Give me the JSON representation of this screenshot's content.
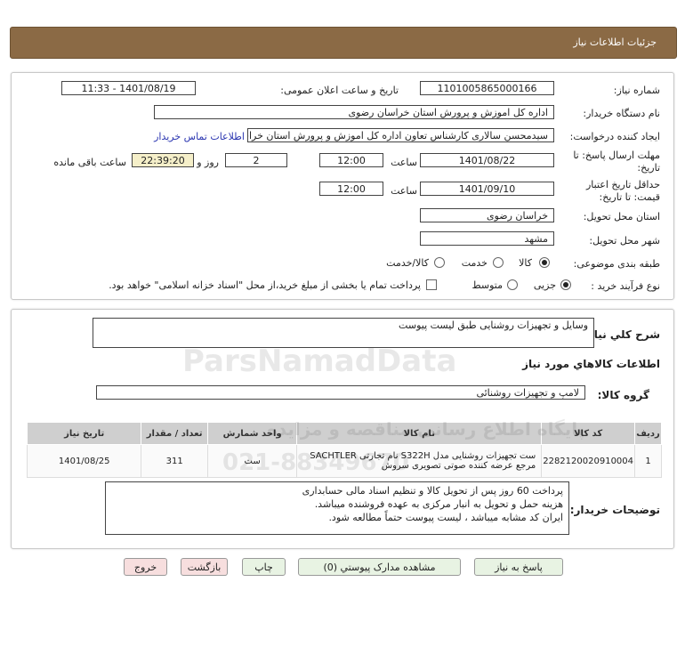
{
  "page_title": "جزئیات اطلاعات نیاز",
  "fields": {
    "need_number_label": "شماره نیاز:",
    "need_number": "1101005865000166",
    "announce_label": "تاریخ و ساعت اعلان عمومی:",
    "announce_value": "1401/08/19 - 11:33",
    "buyer_org_label": "نام دستگاه خریدار:",
    "buyer_org": "اداره کل اموزش و پرورش استان خراسان رضوی",
    "requester_label": "ایجاد کننده درخواست:",
    "requester": "سیدمحسن سالاری کارشناس تعاون اداره کل اموزش و پرورش استان خراسان رضوی",
    "contact_link": "اطلاعات تماس خریدار",
    "deadline_label_1": "مهلت ارسال پاسخ: تا",
    "deadline_label_2": "تاریخ:",
    "deadline_date": "1401/08/22",
    "time_label": "ساعت",
    "deadline_time": "12:00",
    "days_value": "2",
    "days_label": "روز و",
    "remaining_time": "22:39:20",
    "remaining_label": "ساعت باقی مانده",
    "validity_label_1": "حداقل تاریخ اعتبار",
    "validity_label_2": "قیمت: تا تاریخ:",
    "validity_date": "1401/09/10",
    "validity_time": "12:00",
    "province_label": "استان محل تحویل:",
    "province": "خراسان رضوی",
    "city_label": "شهر محل تحویل:",
    "city": "مشهد",
    "category_label": "طبقه بندی موضوعی:",
    "category_options": [
      "کالا",
      "خدمت",
      "کالا/خدمت"
    ],
    "category_selected": "کالا",
    "purchase_type_label": "نوع فرآیند خرید :",
    "purchase_options": [
      "جزیی",
      "متوسط"
    ],
    "purchase_selected": "جزیی",
    "payment_note": "پرداخت تمام یا بخشی از مبلغ خرید،از محل \"اسناد خزانه اسلامی\" خواهد بود."
  },
  "summary": {
    "label": "شرح کلي نياز:",
    "value": "وسایل و تجهیزات روشنایی طبق لیست پیوست"
  },
  "goods_section_title": "اطلاعات کالاهاي مورد نياز",
  "goods_group": {
    "label": "گروه کالا:",
    "value": "لامپ و تجهیزات روشنائی"
  },
  "table": {
    "headers": [
      "ردیف",
      "کد کالا",
      "نام کالا",
      "واحد شمارش",
      "تعداد / مقدار",
      "تاریخ نیاز"
    ],
    "rows": [
      {
        "row": "1",
        "code": "2282120020910004",
        "name_line1": "ست تجهیزات روشنایی مدل S322H نام تجارتی SACHTLER",
        "name_line2": "مرجع عرضه کننده صوتی تصویری سروش",
        "unit": "ست",
        "qty": "311",
        "date": "1401/08/25"
      }
    ]
  },
  "buyer_notes": {
    "label": "توضیحات خریدار:",
    "lines": [
      "پرداخت 60 روز پس از تحویل کالا و تنظیم اسناد مالی حسابداری",
      "هزینه حمل و تحویل به انبار مرکزی به عهده فروشنده میباشد.",
      "ایران کد مشابه میباشد ، لیست پیوست حتماً مطالعه شود."
    ]
  },
  "buttons": {
    "reply": "پاسخ به نیاز",
    "attachments": "مشاهده مدارک پیوستي (0)",
    "print": "چاپ",
    "back": "بازگشت",
    "exit": "خروج"
  },
  "watermark": {
    "brand": "ParsNamadData",
    "phone": "021-88349670",
    "persian_line": "پایگاه اطلاع رسانی مناقصه و مزایده"
  }
}
